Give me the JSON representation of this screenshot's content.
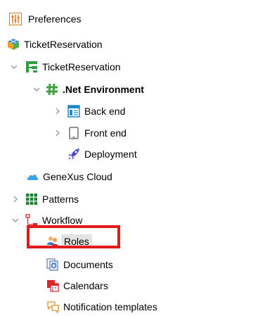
{
  "header": {
    "title": "Preferences",
    "icon": "preferences-icon"
  },
  "tree": {
    "kb": {
      "label": "TicketReservation",
      "icon": "kb-cube-icon"
    },
    "module": {
      "label": "TicketReservation",
      "icon": "module-icon"
    },
    "environment": {
      "label": ".Net Environment",
      "icon": "net-environment-icon"
    },
    "backend": {
      "label": "Back end",
      "icon": "backend-icon"
    },
    "frontend": {
      "label": "Front end",
      "icon": "frontend-icon"
    },
    "deployment": {
      "label": "Deployment",
      "icon": "rocket-icon"
    },
    "cloud": {
      "label": "GeneXus Cloud",
      "icon": "cloud-icon"
    },
    "patterns": {
      "label": "Patterns",
      "icon": "patterns-icon"
    },
    "workflow": {
      "label": "Workflow",
      "icon": "workflow-icon"
    },
    "roles": {
      "label": "Roles",
      "icon": "roles-icon"
    },
    "documents": {
      "label": "Documents",
      "icon": "documents-icon"
    },
    "calendars": {
      "label": "Calendars",
      "icon": "calendars-icon"
    },
    "notifications": {
      "label": "Notification templates",
      "icon": "notification-icon"
    }
  },
  "colors": {
    "highlight": "#e21a1a",
    "selection": "#e3e3e3"
  }
}
